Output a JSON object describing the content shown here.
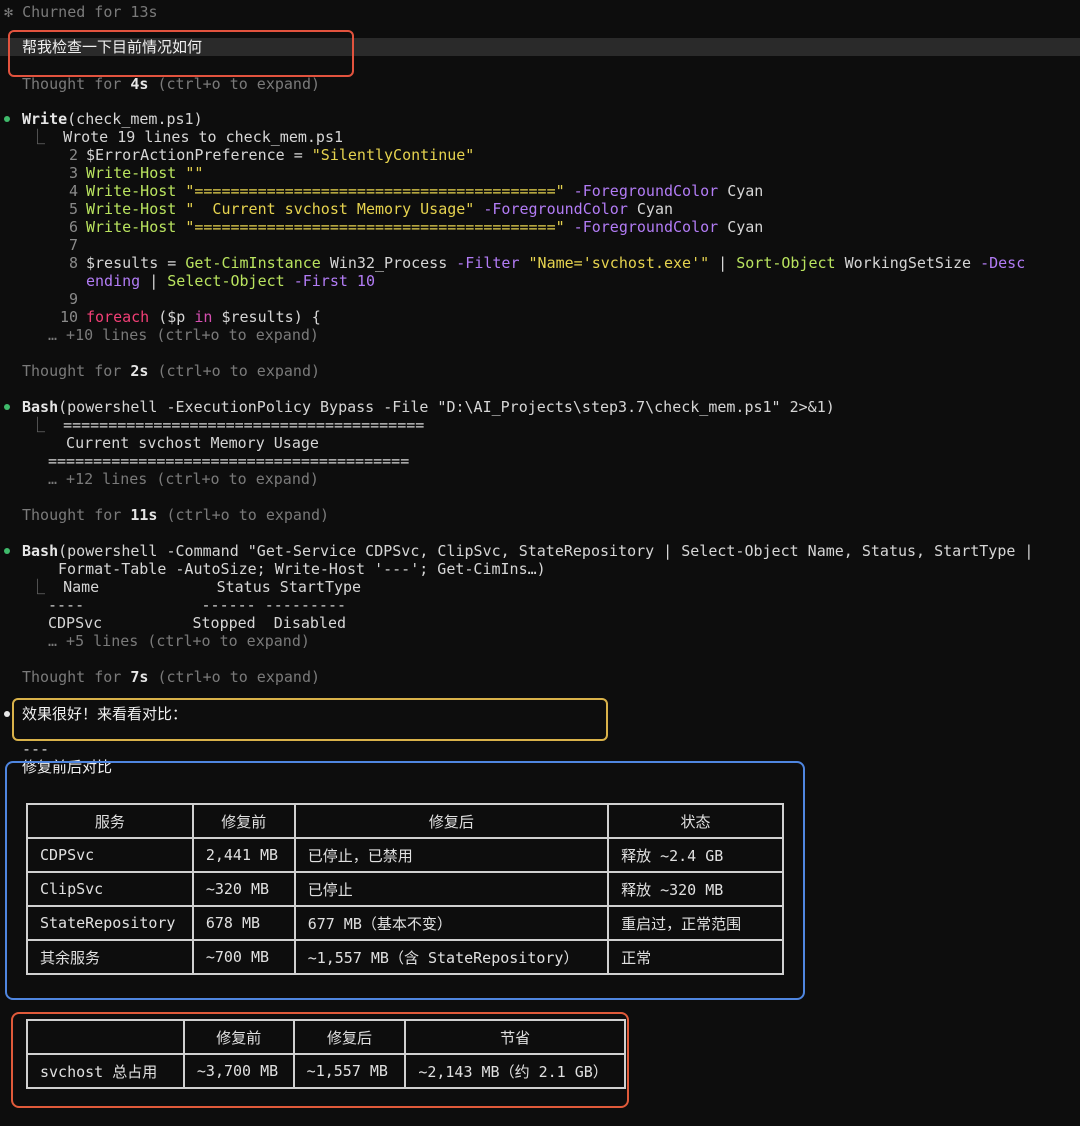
{
  "status": {
    "glyph": "✻",
    "text": "Churned for 13s"
  },
  "user_prompt": "帮我检查一下目前情况如何",
  "thought1": {
    "pre": "Thought for ",
    "dur": "4s",
    "post": " (ctrl+o to expand)"
  },
  "write": {
    "tool": "Write",
    "arg": "(check_mem.ps1)",
    "summary": "Wrote 19 lines to check_mem.ps1",
    "lines": {
      "n2": "2",
      "l2a": "$ErrorActionPreference = ",
      "l2b": "\"SilentlyContinue\"",
      "n3": "3",
      "l3a": "Write-Host",
      "l3b": " \"\"",
      "n4": "4",
      "l4a": "Write-Host",
      "l4b": " \"========================================\"",
      "l4c": " -ForegroundColor",
      "l4d": " Cyan",
      "n5": "5",
      "l5a": "Write-Host",
      "l5b": " \"  Current svchost Memory Usage\"",
      "l5c": " -ForegroundColor",
      "l5d": " Cyan",
      "n6": "6",
      "l6a": "Write-Host",
      "l6b": " \"========================================\"",
      "l6c": " -ForegroundColor",
      "l6d": " Cyan",
      "n7": "7",
      "n8": "8",
      "l8a": "$results = ",
      "l8b": "Get-CimInstance",
      "l8c": " Win32_Process ",
      "l8d": "-Filter",
      "l8e": " \"Name='svchost.exe'\"",
      "l8f": " | ",
      "l8g": "Sort-Object",
      "l8h": " WorkingSetSize ",
      "l8i": "-Desc",
      "l8j": "ending",
      "l8k": " | ",
      "l8l": "Select-Object",
      "l8m": " -First",
      "l8n": " 10",
      "n9": "9",
      "n10": "10",
      "l10a": "foreach",
      "l10b": " ($p ",
      "l10c": "in",
      "l10d": " $results) {"
    },
    "more": "… +10 lines (ctrl+o to expand)"
  },
  "thought2": {
    "pre": "Thought for ",
    "dur": "2s",
    "post": " (ctrl+o to expand)"
  },
  "bash1": {
    "tool": "Bash",
    "arg": "(powershell -ExecutionPolicy Bypass -File \"D:\\AI_Projects\\step3.7\\check_mem.ps1\" 2>&1)",
    "out1": "========================================",
    "out2": "  Current svchost Memory Usage",
    "out3": "========================================",
    "more": "… +12 lines (ctrl+o to expand)"
  },
  "thought3": {
    "pre": "Thought for ",
    "dur": "11s",
    "post": " (ctrl+o to expand)"
  },
  "bash2": {
    "tool": "Bash",
    "arg1": "(powershell -Command \"Get-Service CDPSvc, ClipSvc, StateRepository | Select-Object Name, Status, StartType |",
    "arg2": "Format-Table -AutoSize; Write-Host '---'; Get-CimIns…)",
    "out1": "Name             Status StartType",
    "out2": "----             ------ ---------",
    "out3": "CDPSvc          Stopped  Disabled",
    "more": "… +5 lines (ctrl+o to expand)"
  },
  "thought4": {
    "pre": "Thought for ",
    "dur": "7s",
    "post": " (ctrl+o to expand)"
  },
  "reply": "效果很好！来看看对比：",
  "hr": "---",
  "section_title": "修复前后对比",
  "table1": {
    "headers": [
      "服务",
      "修复前",
      "修复后",
      "状态"
    ],
    "rows": [
      [
        "CDPSvc",
        "2,441 MB",
        "已停止，已禁用",
        "释放 ~2.4 GB"
      ],
      [
        "ClipSvc",
        "~320 MB",
        "已停止",
        "释放 ~320 MB"
      ],
      [
        "StateRepository",
        "678 MB",
        "677 MB（基本不变）",
        "重启过，正常范围"
      ],
      [
        "其余服务",
        "~700 MB",
        "~1,557 MB（含 StateRepository）",
        "正常"
      ]
    ]
  },
  "table2": {
    "headers": [
      "",
      "修复前",
      "修复后",
      "节省"
    ],
    "rows": [
      [
        "svchost 总占用",
        "~3,700 MB",
        "~1,557 MB",
        "~2,143 MB（约 2.1 GB）"
      ]
    ]
  },
  "colors": {
    "red_box": "#e2533e",
    "yellow_box": "#d9b24a",
    "blue_box": "#4f86e0",
    "orange_box": "#e05a3a",
    "green_dot": "#3fba6b"
  }
}
